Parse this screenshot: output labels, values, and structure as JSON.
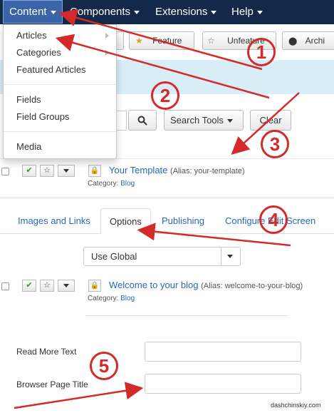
{
  "navbar": {
    "items": [
      {
        "label": "Content"
      },
      {
        "label": "Components"
      },
      {
        "label": "Extensions"
      },
      {
        "label": "Help"
      }
    ]
  },
  "toolbar": {
    "feature_label": "Feature",
    "unfeature_label": "Unfeature",
    "archive_label": "Archi"
  },
  "dropdown": {
    "items": [
      {
        "label": "Articles"
      },
      {
        "label": "Categories"
      },
      {
        "label": "Featured Articles"
      },
      {
        "label": "Fields"
      },
      {
        "label": "Field Groups"
      },
      {
        "label": "Media"
      }
    ]
  },
  "search": {
    "tools_label": "Search Tools",
    "clear_label": "Clear"
  },
  "articles": [
    {
      "title": "Your Template",
      "alias": "(Alias: your-template)",
      "category_label": "Category:",
      "category": "Blog"
    },
    {
      "title": "Welcome to your blog",
      "alias": "(Alias: welcome-to-your-blog)",
      "category_label": "Category:",
      "category": "Blog"
    }
  ],
  "tabs": [
    {
      "label": "Images and Links"
    },
    {
      "label": "Options"
    },
    {
      "label": "Publishing"
    },
    {
      "label": "Configure Edit Screen"
    }
  ],
  "select": {
    "value": "Use Global"
  },
  "fields": {
    "read_more_label": "Read More Text",
    "browser_title_label": "Browser Page Title"
  },
  "annotations": [
    "1",
    "2",
    "3",
    "4",
    "5"
  ],
  "watermark": "dashchinskiy.com",
  "colors": {
    "navbar": "#142849",
    "accent": "#d42a2a",
    "link": "#2a69b8"
  }
}
